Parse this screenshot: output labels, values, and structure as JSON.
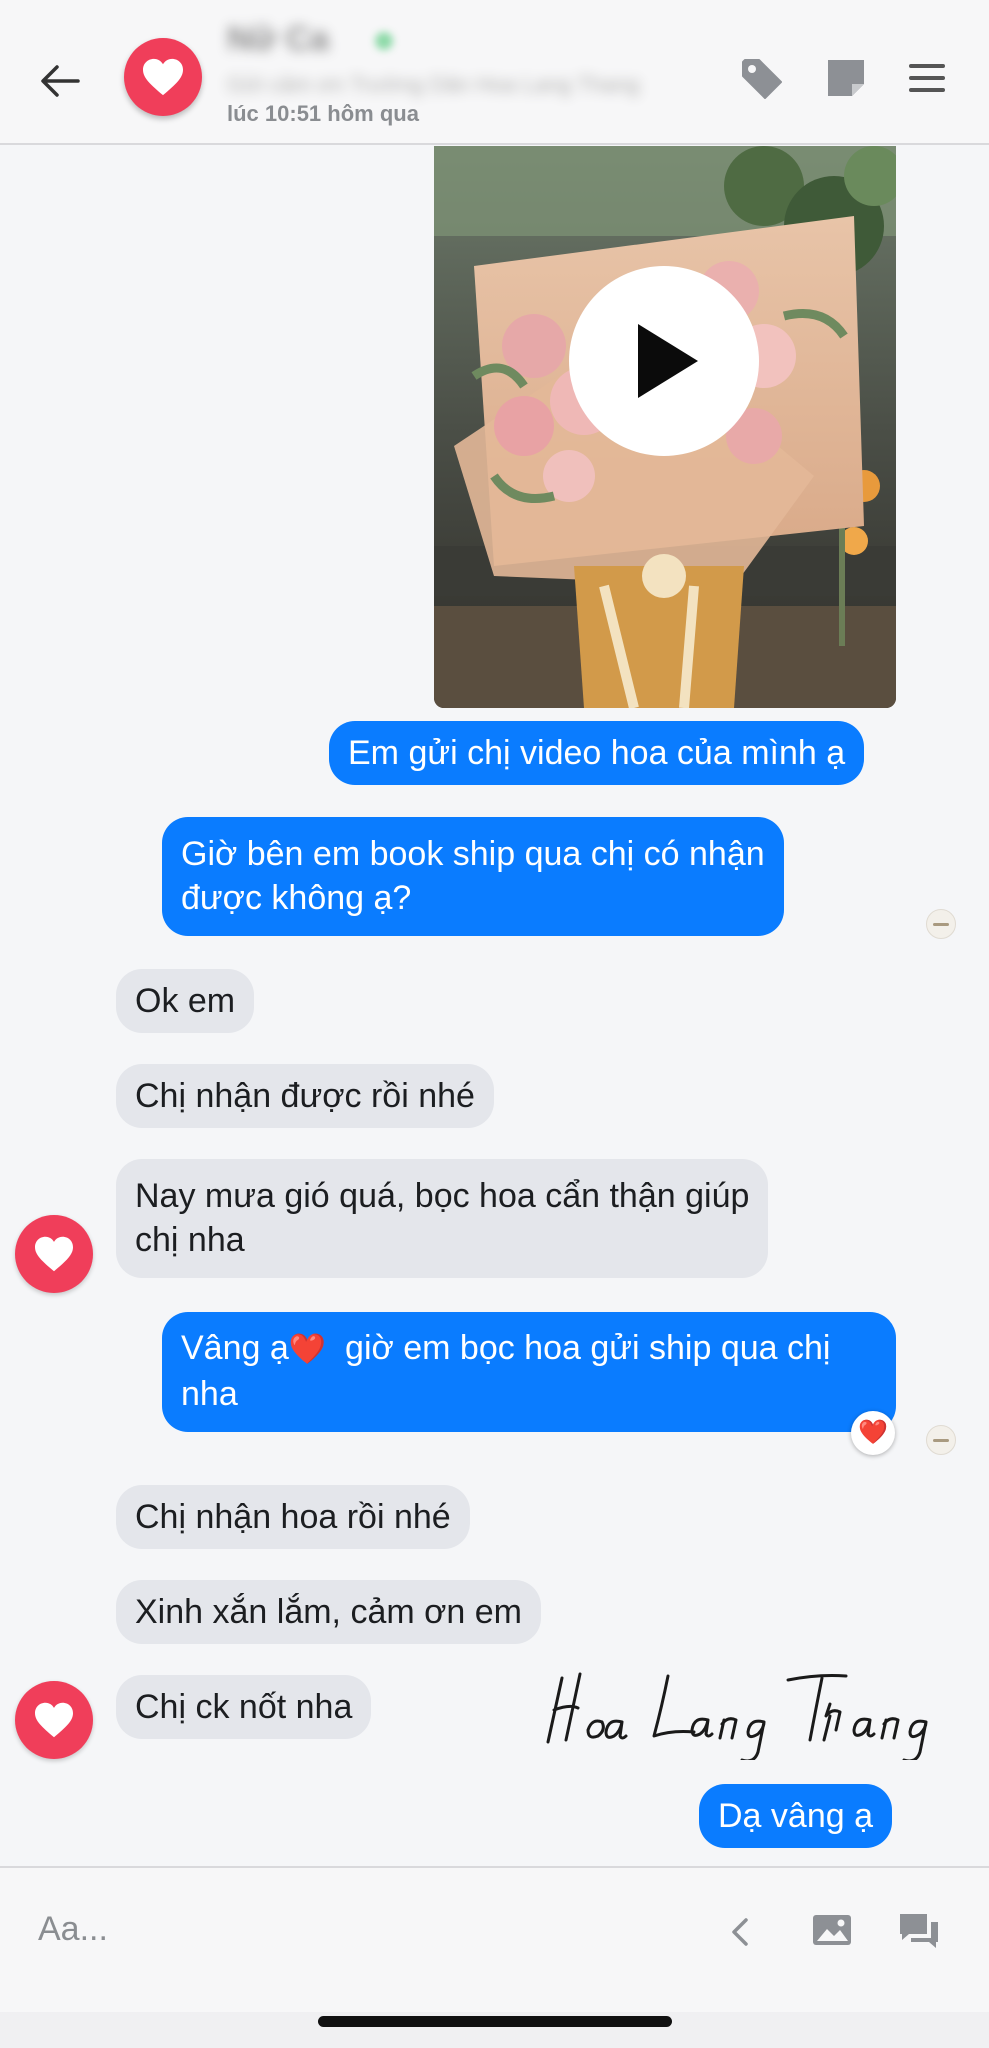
{
  "header": {
    "contact_name": "Nữ Ca",
    "contact_subtitle": "Gửi cảm ơn Trường Dân Hoa Lang Thang",
    "last_seen": "lúc 10:51 hôm qua",
    "icons": [
      "back-arrow-icon",
      "heart-avatar",
      "tag-icon",
      "note-icon",
      "menu-icon"
    ]
  },
  "messages": [
    {
      "type": "video",
      "direction": "outgoing",
      "icon": "play-icon"
    },
    {
      "direction": "outgoing",
      "lines": [
        "Em gửi chị video hoa của mình ạ"
      ]
    },
    {
      "direction": "outgoing",
      "lines": [
        "Giờ bên em book ship qua chị có nhận",
        "được không ạ?"
      ]
    },
    {
      "direction": "incoming",
      "lines": [
        "Ok em"
      ]
    },
    {
      "direction": "incoming",
      "lines": [
        "Chị nhận được rồi nhé"
      ]
    },
    {
      "direction": "incoming",
      "lines": [
        "Nay mưa gió quá, bọc hoa cẩn thận giúp",
        "chị nha"
      ]
    },
    {
      "direction": "outgoing",
      "lines": [
        "Vâng ạ",
        "giờ em bọc hoa gửi ship qua chị",
        "nha"
      ],
      "emoji": "❤️",
      "reaction": "❤️"
    },
    {
      "direction": "incoming",
      "lines": [
        "Chị nhận hoa rồi nhé"
      ]
    },
    {
      "direction": "incoming",
      "lines": [
        "Xinh xắn lắm, cảm ơn em"
      ]
    },
    {
      "direction": "incoming",
      "lines": [
        "Chị ck nốt nha"
      ]
    },
    {
      "direction": "outgoing",
      "lines": [
        "Dạ vâng ạ"
      ]
    }
  ],
  "watermark": "Hoa Lang Thang",
  "composer": {
    "placeholder": "Aa...",
    "icons": [
      "chevron-left-icon",
      "image-icon",
      "quick-reply-icon"
    ]
  },
  "colors": {
    "outgoing_bubble": "#0a7cff",
    "incoming_bubble": "#e4e6eb",
    "avatar": "#f03e5a",
    "background": "#f5f6f8"
  }
}
